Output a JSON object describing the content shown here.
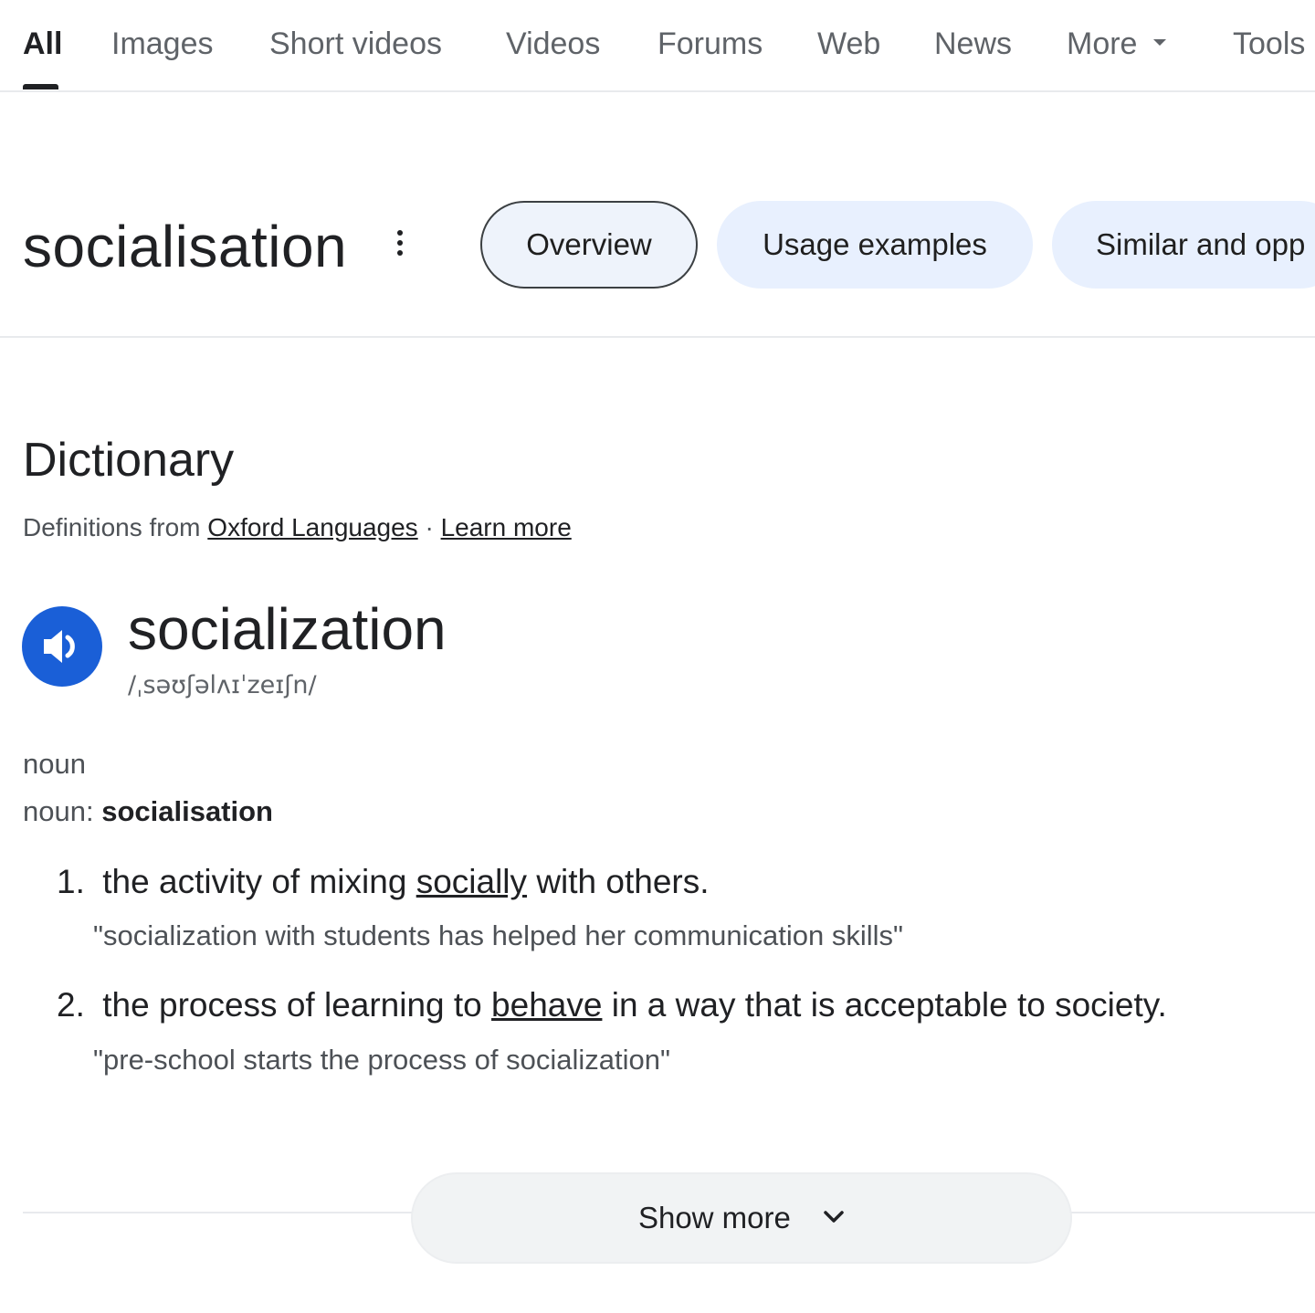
{
  "tabs": [
    {
      "label": "All",
      "active": true
    },
    {
      "label": "Images"
    },
    {
      "label": "Short videos"
    },
    {
      "label": "Videos"
    },
    {
      "label": "Forums"
    },
    {
      "label": "Web"
    },
    {
      "label": "News"
    },
    {
      "label": "More"
    },
    {
      "label": "Tools"
    }
  ],
  "query": {
    "title": "socialisation",
    "chips": [
      "Overview",
      "Usage examples",
      "Similar and opp"
    ]
  },
  "dictionary": {
    "heading": "Dictionary",
    "source_prefix": "Definitions from",
    "source_link": "Oxford Languages",
    "separator": "·",
    "learn_more": "Learn more",
    "headword": "socialization",
    "phonetic": "/ˌsəʊʃəlʌɪˈzeɪʃn/",
    "pos": "noun",
    "variant_label": "noun:",
    "variant_word": "socialisation",
    "senses": [
      {
        "num": "1.",
        "pre": "the activity of mixing",
        "link": "socially",
        "post": "with others.",
        "example": "\"socialization with students has helped her communication skills\""
      },
      {
        "num": "2.",
        "pre": "the process of learning to",
        "link": "behave",
        "post": "in a way that is acceptable to society.",
        "example": "\"pre-school starts the process of socialization\""
      }
    ],
    "show_more": "Show more"
  },
  "colors": {
    "accent_blue": "#1a5fd7",
    "chip_fill": "#e8f0fe",
    "text_primary": "#202124",
    "text_secondary": "#5f6368"
  },
  "icons": [
    "speaker-icon",
    "kebab-menu-icon",
    "caret-down-icon",
    "chevron-down-icon"
  ]
}
